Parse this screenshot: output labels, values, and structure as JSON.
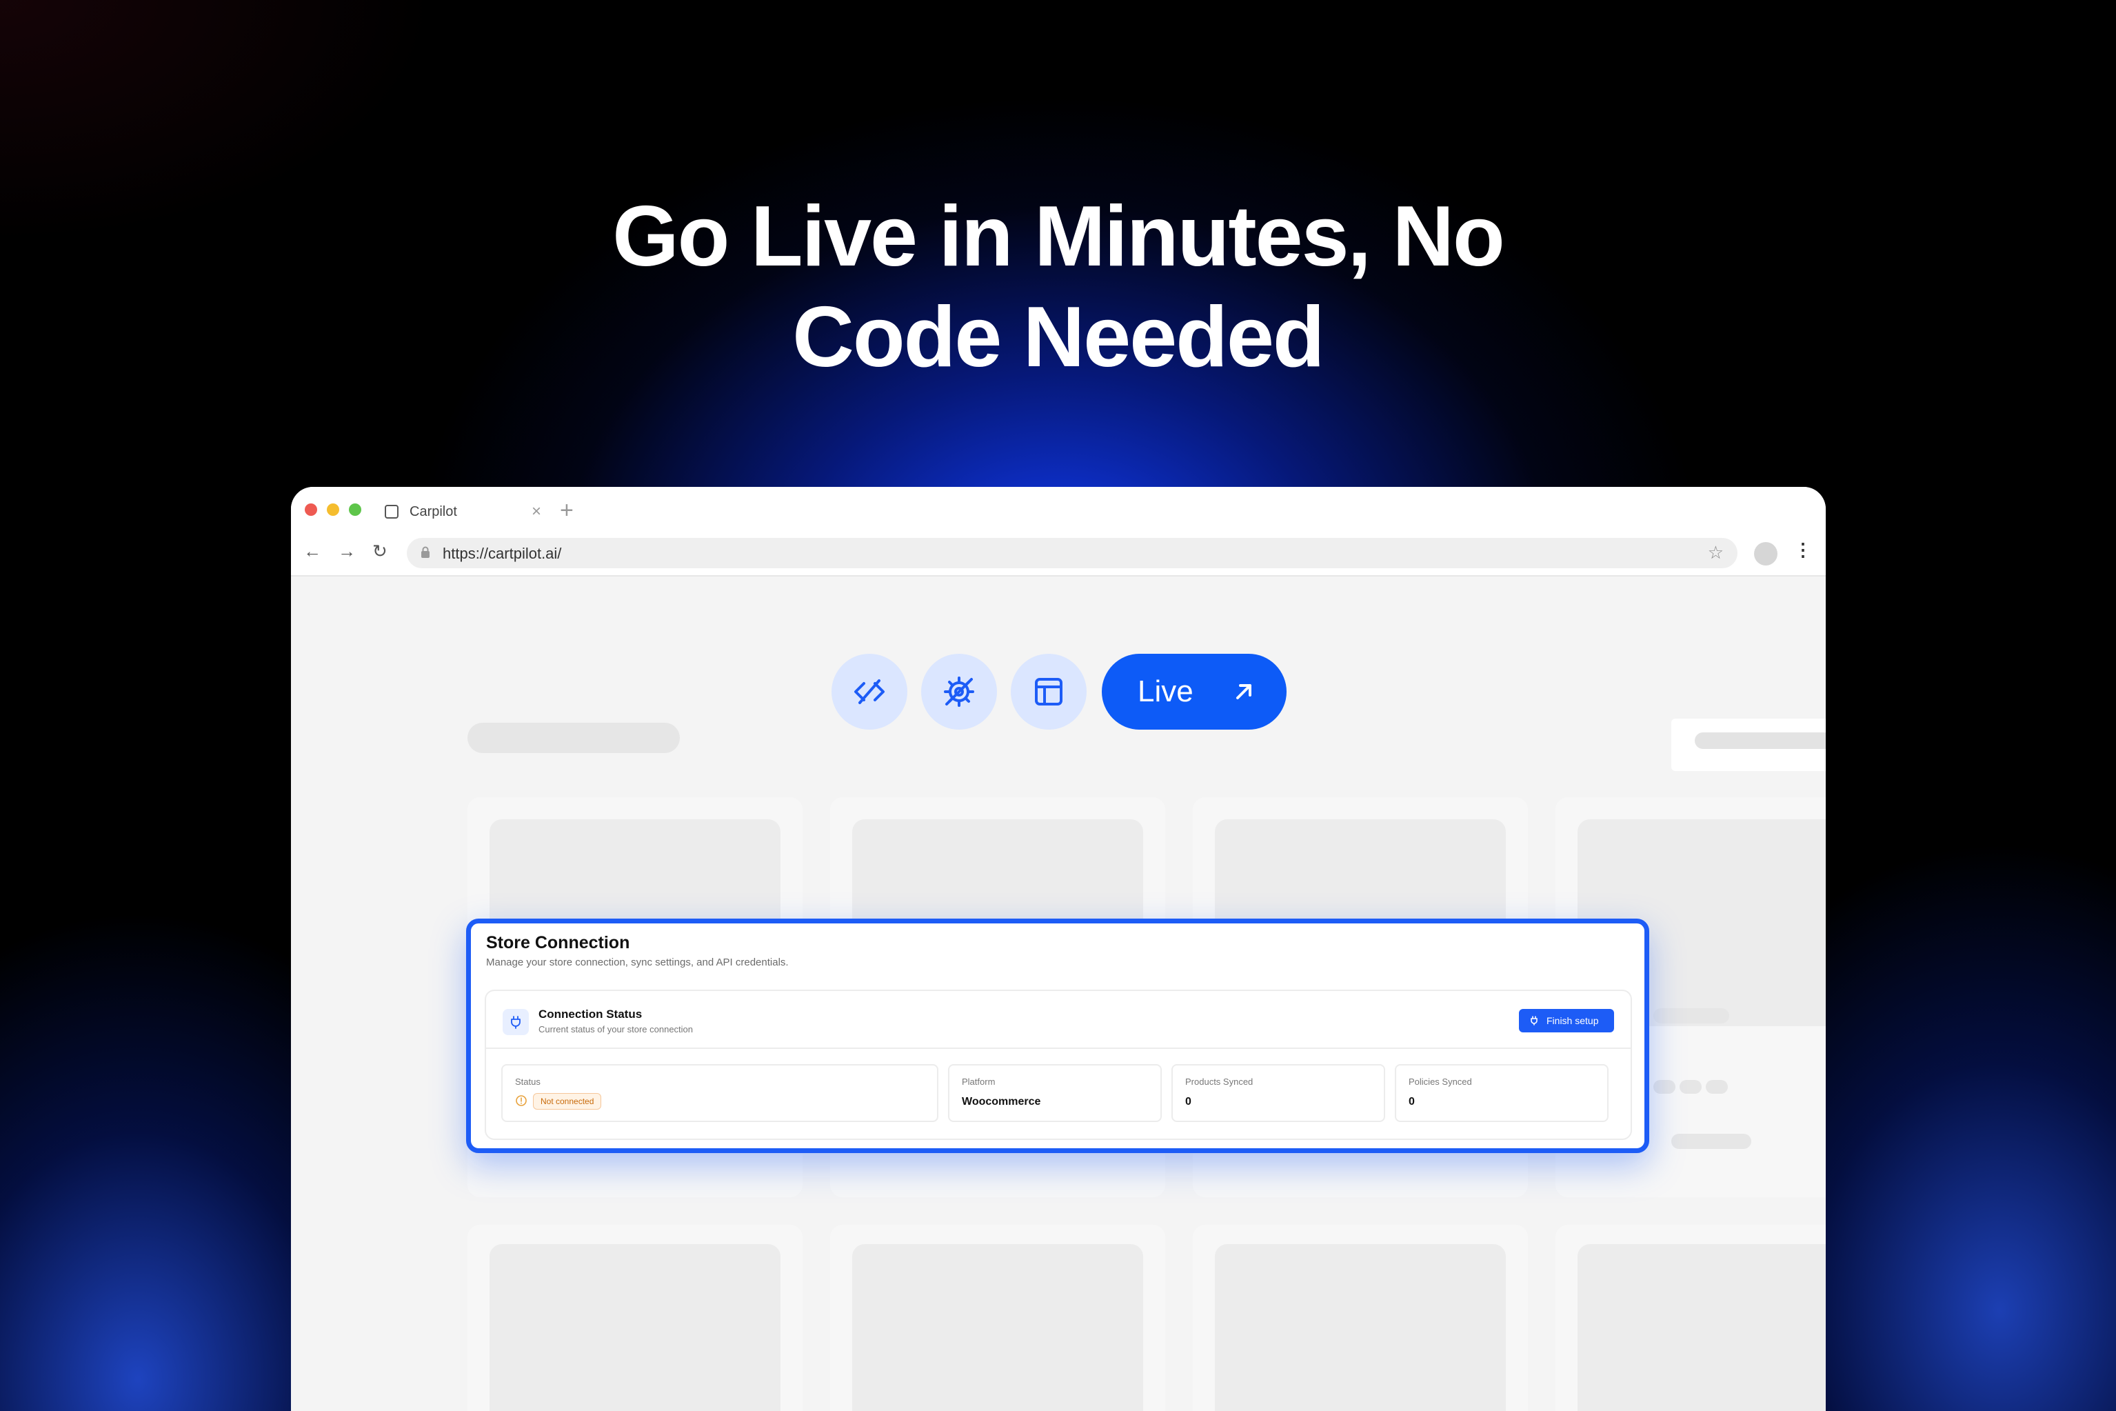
{
  "headline": {
    "line1": "Go Live in Minutes, No",
    "line2": "Code Needed"
  },
  "browser": {
    "tab_title": "Carpilot",
    "tab_close": "×",
    "new_tab": "+",
    "url": "https://cartpilot.ai/",
    "back": "←",
    "forward": "→",
    "reload": "↻",
    "star": "☆",
    "menu": "⋮"
  },
  "toolbar": {
    "icons": [
      "unlink-code-icon",
      "gear-icon",
      "layout-icon"
    ],
    "live_label": "Live"
  },
  "store_connection": {
    "title": "Store Connection",
    "subtitle": "Manage your store connection, sync settings, and API credentials.",
    "connection_status": {
      "title": "Connection Status",
      "subtitle": "Current status of your store connection",
      "finish_label": "Finish setup"
    },
    "stats": {
      "status_label": "Status",
      "status_value": "Not connected",
      "platform_label": "Platform",
      "platform_value": "Woocommerce",
      "products_label": "Products Synced",
      "products_value": "0",
      "policies_label": "Policies Synced",
      "policies_value": "0"
    }
  },
  "colors": {
    "accent": "#0d5bf7",
    "panel_border": "#1d5cf6",
    "icon_bg": "#dbe6ff",
    "warning": "#c86a0a"
  }
}
